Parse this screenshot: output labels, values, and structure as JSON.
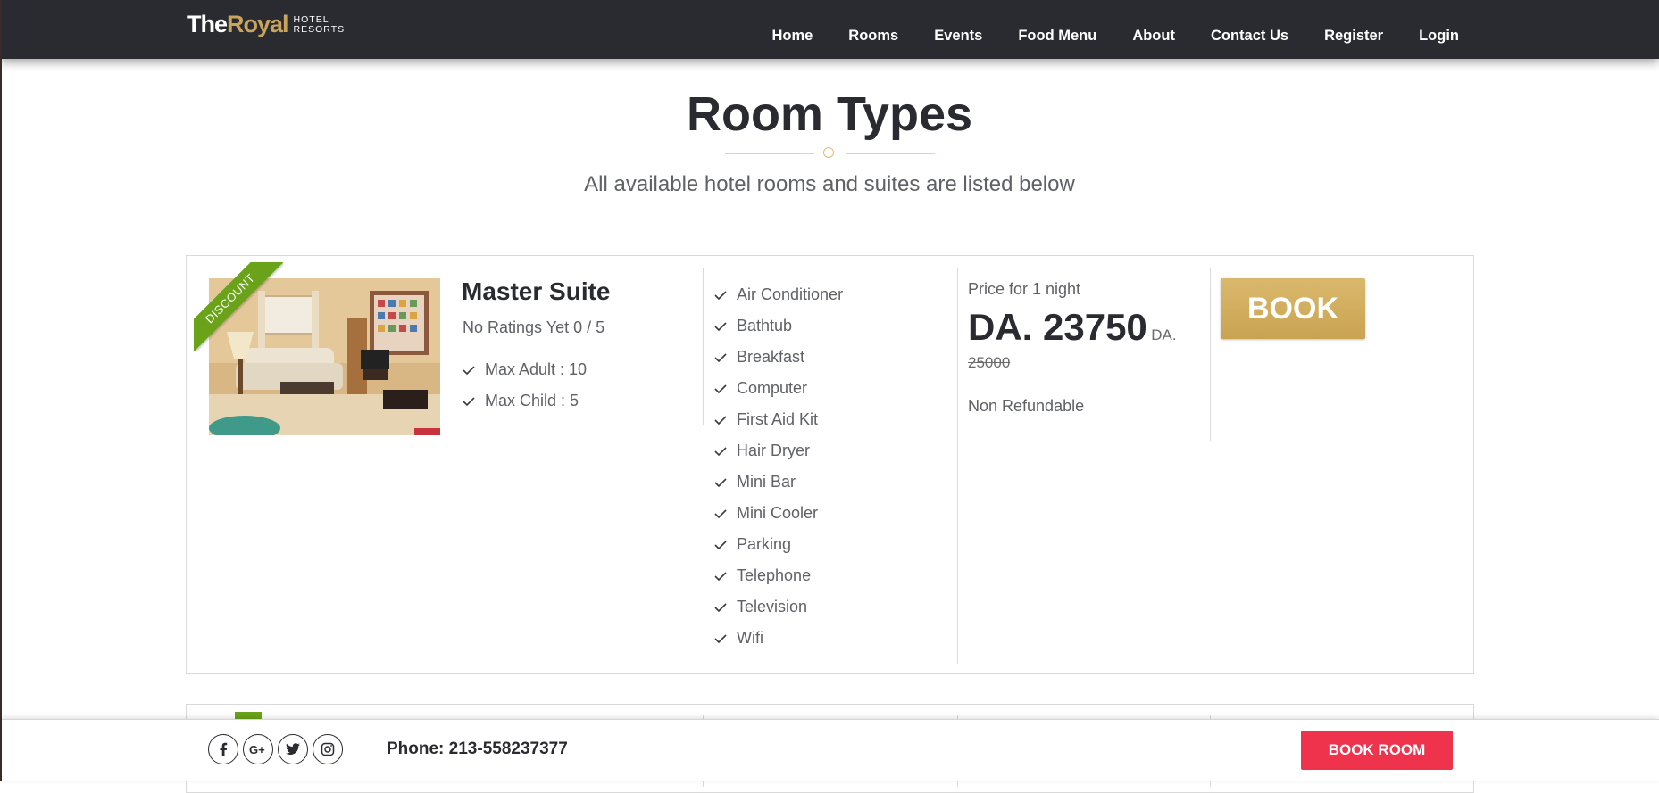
{
  "brand": {
    "the": "The",
    "royal": "Royal",
    "sub1": "HOTEL",
    "sub2": "RESORTS"
  },
  "nav": [
    "Home",
    "Rooms",
    "Events",
    "Food Menu",
    "About",
    "Contact Us",
    "Register",
    "Login"
  ],
  "page": {
    "title": "Room Types",
    "subtitle": "All available hotel rooms and suites are listed below"
  },
  "room": {
    "badge": "DISCOUNT",
    "name": "Master Suite",
    "rating": "No Ratings Yet 0 / 5",
    "occupancy": [
      "Max Adult : 10",
      "Max Child : 5"
    ],
    "features": [
      "Air Conditioner",
      "Bathtub",
      "Breakfast",
      "Computer",
      "First Aid Kit",
      "Hair Dryer",
      "Mini Bar",
      "Mini Cooler",
      "Parking",
      "Telephone",
      "Television",
      "Wifi"
    ],
    "price_label": "Price for 1 night",
    "price_new": "DA. 23750",
    "price_old": "DA. 25000",
    "refund": "Non Refundable",
    "book_label": "BOOK"
  },
  "footer": {
    "socials": [
      "facebook-icon",
      "google-plus-icon",
      "twitter-icon",
      "instagram-icon"
    ],
    "phone": "Phone: 213-558237377",
    "book_room_label": "BOOK ROOM"
  },
  "colors": {
    "header": "#2a2b30",
    "gold": "#c9a45c",
    "ribbon": "#6aa21a",
    "book_room": "#f0334d"
  }
}
